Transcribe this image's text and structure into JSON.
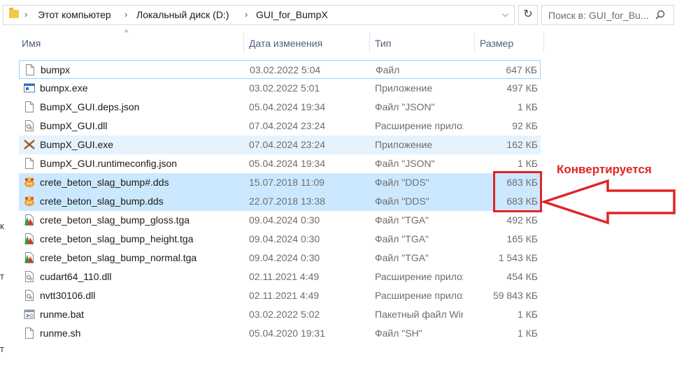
{
  "breadcrumb": [
    "Этот компьютер",
    "Локальный диск (D:)",
    "GUI_for_BumpX"
  ],
  "search": {
    "placeholder": "Поиск в: GUI_for_Bu..."
  },
  "nav_glyphs": [
    "к",
    "т",
    "т"
  ],
  "columns": {
    "name": "Имя",
    "date": "Дата изменения",
    "type": "Тип",
    "size": "Размер"
  },
  "files": [
    {
      "name": "bumpx",
      "date": "03.02.2022 5:04",
      "type": "Файл",
      "size": "647 КБ",
      "icon": "file-icon"
    },
    {
      "name": "bumpx.exe",
      "date": "03.02.2022 5:01",
      "type": "Приложение",
      "size": "497 КБ",
      "icon": "exe-icon"
    },
    {
      "name": "BumpX_GUI.deps.json",
      "date": "05.04.2024 19:34",
      "type": "Файл \"JSON\"",
      "size": "1 КБ",
      "icon": "file-icon"
    },
    {
      "name": "BumpX_GUI.dll",
      "date": "07.04.2024 23:24",
      "type": "Расширение приложения",
      "size": "92 КБ",
      "icon": "dll-icon"
    },
    {
      "name": "BumpX_GUI.exe",
      "date": "07.04.2024 23:24",
      "type": "Приложение",
      "size": "162 КБ",
      "icon": "bumpx-app-icon"
    },
    {
      "name": "BumpX_GUI.runtimeconfig.json",
      "date": "05.04.2024 19:34",
      "type": "Файл \"JSON\"",
      "size": "1 КБ",
      "icon": "file-icon"
    },
    {
      "name": "crete_beton_slag_bump#.dds",
      "date": "15.07.2018 11:09",
      "type": "Файл \"DDS\"",
      "size": "683 КБ",
      "icon": "dds-icon"
    },
    {
      "name": "crete_beton_slag_bump.dds",
      "date": "22.07.2018 13:38",
      "type": "Файл \"DDS\"",
      "size": "683 КБ",
      "icon": "dds-icon"
    },
    {
      "name": "crete_beton_slag_bump_gloss.tga",
      "date": "09.04.2024 0:30",
      "type": "Файл \"TGA\"",
      "size": "492 КБ",
      "icon": "tga-icon"
    },
    {
      "name": "crete_beton_slag_bump_height.tga",
      "date": "09.04.2024 0:30",
      "type": "Файл \"TGA\"",
      "size": "165 КБ",
      "icon": "tga-icon"
    },
    {
      "name": "crete_beton_slag_bump_normal.tga",
      "date": "09.04.2024 0:30",
      "type": "Файл \"TGA\"",
      "size": "1 543 КБ",
      "icon": "tga-icon"
    },
    {
      "name": "cudart64_110.dll",
      "date": "02.11.2021 4:49",
      "type": "Расширение приложения",
      "size": "454 КБ",
      "icon": "dll-icon"
    },
    {
      "name": "nvtt30106.dll",
      "date": "02.11.2021 4:49",
      "type": "Расширение приложения",
      "size": "59 843 КБ",
      "icon": "dll-icon"
    },
    {
      "name": "runme.bat",
      "date": "03.02.2022 5:02",
      "type": "Пакетный файл Windows",
      "size": "1 КБ",
      "icon": "bat-icon"
    },
    {
      "name": "runme.sh",
      "date": "05.04.2020 19:31",
      "type": "Файл \"SH\"",
      "size": "1 КБ",
      "icon": "file-icon"
    }
  ],
  "annotation": {
    "text": "Конвертируется",
    "color": "#e02424"
  },
  "colors": {
    "selected": "#cce8ff",
    "hover": "#e5f3ff",
    "focus_border": "#99d1ff",
    "header_text": "#4c607a"
  }
}
